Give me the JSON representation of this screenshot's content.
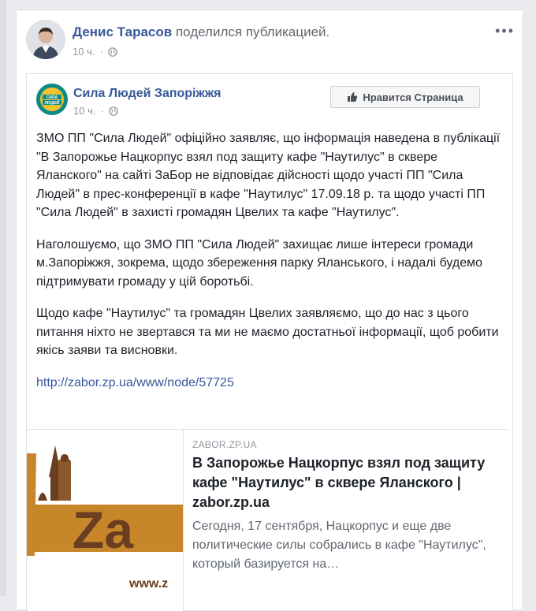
{
  "post": {
    "author": "Денис Тарасов",
    "action": "поделился публикацией.",
    "time": "10 ч.",
    "more_label": "•••"
  },
  "shared": {
    "page_name": "Сила Людей Запоріжжя",
    "logo_text": [
      "СИЛА",
      "ЛЮДЕЙ"
    ],
    "time": "10 ч.",
    "like_button_label": "Нравится Страница",
    "paragraphs": [
      "ЗМО ПП \"Сила Людей\" офіційно заявляє, що інформація наведена в публікації \"В Запорожье Нацкорпус взял под защиту кафе \"Наутилус\" в сквере Яланского\" на сайті ЗаБор не відповідає дійсності щодо участі ПП \"Сила Людей\" в прес-конференції в кафе \"Наутилус\" 17.09.18 р. та щодо участі ПП \"Сила Людей\" в захисті громадян Цвелих та кафе \"Наутилус\".",
      "Наголошуємо, що ЗМО ПП \"Сила Людей\" захищає лише інтереси громади м.Запоріжжя, зокрема, щодо збереження парку Яланського, і надалі будемо підтримувати громаду у цій боротьбі.",
      "Щодо кафе \"Наутилус\" та громадян Цвелих заявляємо, що до нас з цього питання ніхто не звертався та ми не маємо достатньої інформації, щоб робити якісь заяви та висновки."
    ],
    "link": "http://zabor.zp.ua/www/node/57725"
  },
  "preview": {
    "domain": "ZABOR.ZP.UA",
    "title": "В Запорожье Нацкорпус взял под защиту кафе \"Наутилус\" в сквере Яланского | zabor.zp.ua",
    "description": "Сегодня, 17 сентября, Нацкорпус и еще две политические силы собрались в кафе \"Наутилус\", который базируется на…",
    "image_text": "Za",
    "image_url_text": "www.z"
  },
  "colors": {
    "link": "#365899",
    "background": "#e9ebee",
    "brand_orange": "#c8862a",
    "brand_brown": "#6b3e1f"
  }
}
